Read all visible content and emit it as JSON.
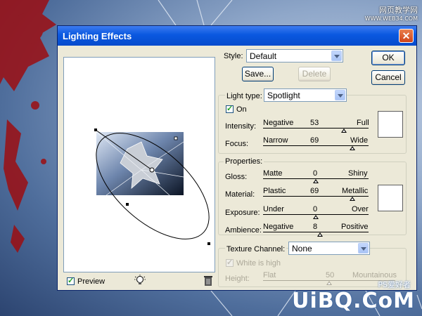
{
  "watermark": {
    "site_cn": "网页教学网",
    "site_url": "WWW.WEB34.COM",
    "brand": "UiBQ.CoM",
    "brand_small": "PS爱好者"
  },
  "dialog": {
    "title": "Lighting Effects",
    "close_label": "✕",
    "ok_label": "OK",
    "cancel_label": "Cancel",
    "style": {
      "label": "Style:",
      "value": "Default",
      "save_label": "Save...",
      "delete_label": "Delete"
    },
    "light_type": {
      "label": "Light type:",
      "value": "Spotlight",
      "on_label": "On",
      "on_checked": true,
      "intensity": {
        "label": "Intensity:",
        "left": "Negative",
        "value": "53",
        "right": "Full",
        "level": 53,
        "min": -100,
        "max": 100
      },
      "focus": {
        "label": "Focus:",
        "left": "Narrow",
        "value": "69",
        "right": "Wide",
        "level": 69,
        "min": -100,
        "max": 100
      }
    },
    "properties": {
      "legend": "Properties:",
      "gloss": {
        "label": "Gloss:",
        "left": "Matte",
        "value": "0",
        "right": "Shiny",
        "level": 0,
        "min": -100,
        "max": 100
      },
      "material": {
        "label": "Material:",
        "left": "Plastic",
        "value": "69",
        "right": "Metallic",
        "level": 69,
        "min": -100,
        "max": 100
      },
      "exposure": {
        "label": "Exposure:",
        "left": "Under",
        "value": "0",
        "right": "Over",
        "level": 0,
        "min": -100,
        "max": 100
      },
      "ambience": {
        "label": "Ambience:",
        "left": "Negative",
        "value": "8",
        "right": "Positive",
        "level": 8,
        "min": -100,
        "max": 100
      }
    },
    "texture": {
      "label": "Texture Channel:",
      "value": "None",
      "white_is_high_label": "White is high",
      "white_is_high_checked": true,
      "height": {
        "label": "Height:",
        "left": "Flat",
        "value": "50",
        "right": "Mountainous",
        "level": 50,
        "min": 0,
        "max": 100
      }
    },
    "preview_label": "Preview",
    "preview_checked": true,
    "colors": {
      "light_color": "#ffffff",
      "ambient_color": "#ffffff"
    }
  }
}
